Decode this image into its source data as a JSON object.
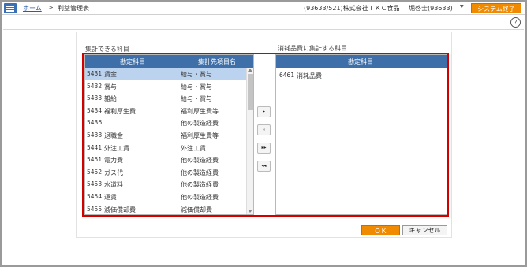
{
  "header": {
    "home": "ホーム",
    "separator": ">",
    "current": "利益管理表",
    "company": "(93633/521)株式会社ＴＫＣ食品",
    "user": "堀啓士(93633)",
    "exit": "システム終了",
    "help": "?"
  },
  "labels": {
    "left": "集計できる科目",
    "right": "消耗品費に集計する科目"
  },
  "left_table": {
    "col_account": "勘定科目",
    "col_dest": "集計先項目名",
    "rows": [
      {
        "code": "5431",
        "name": "賃金",
        "dest": "給与・賞与"
      },
      {
        "code": "5432",
        "name": "賞与",
        "dest": "給与・賞与"
      },
      {
        "code": "5433",
        "name": "雑給",
        "dest": "給与・賞与"
      },
      {
        "code": "5434",
        "name": "福利厚生費",
        "dest": "福利厚生費等"
      },
      {
        "code": "5436",
        "name": "",
        "dest": "他の製造経費"
      },
      {
        "code": "5438",
        "name": "退職金",
        "dest": "福利厚生費等"
      },
      {
        "code": "5441",
        "name": "外注工賃",
        "dest": "外注工賃"
      },
      {
        "code": "5451",
        "name": "電力費",
        "dest": "他の製造経費"
      },
      {
        "code": "5452",
        "name": "ガス代",
        "dest": "他の製造経費"
      },
      {
        "code": "5453",
        "name": "水道料",
        "dest": "他の製造経費"
      },
      {
        "code": "5454",
        "name": "運賃",
        "dest": "他の製造経費"
      },
      {
        "code": "5455",
        "name": "減価償却費",
        "dest": "減価償却費"
      }
    ]
  },
  "right_table": {
    "col_account": "勘定科目",
    "rows": [
      {
        "code": "6461",
        "name": "消耗品費"
      }
    ]
  },
  "move_buttons": {
    "add": "▸",
    "remove": "◂",
    "add_all": "▸▸",
    "remove_all": "◂◂"
  },
  "footer": {
    "ok": "ＯＫ",
    "cancel": "キャンセル"
  }
}
